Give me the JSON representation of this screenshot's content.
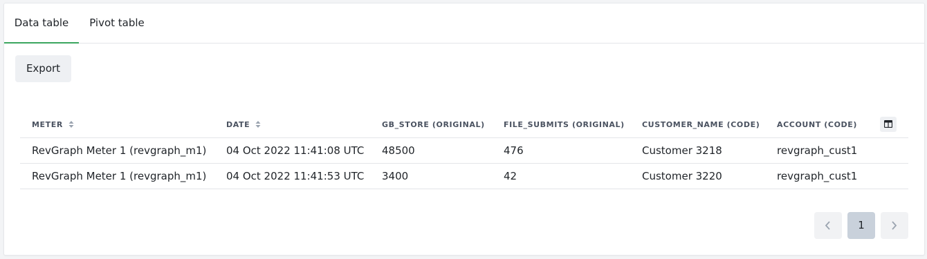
{
  "tabs": [
    {
      "label": "Data table",
      "active": true
    },
    {
      "label": "Pivot table",
      "active": false
    }
  ],
  "toolbar": {
    "export_label": "Export"
  },
  "table": {
    "columns": [
      {
        "label": "METER",
        "sortable": true
      },
      {
        "label": "DATE",
        "sortable": true
      },
      {
        "label": "GB_STORE (ORIGINAL)",
        "sortable": false
      },
      {
        "label": "FILE_SUBMITS (ORIGINAL)",
        "sortable": false
      },
      {
        "label": "CUSTOMER_NAME (CODE)",
        "sortable": false
      },
      {
        "label": "ACCOUNT (CODE)",
        "sortable": false
      }
    ],
    "column_toggle_icon": "columns-icon",
    "rows": [
      [
        "RevGraph Meter 1 (revgraph_m1)",
        "04 Oct 2022 11:41:08 UTC",
        "48500",
        "476",
        "Customer 3218",
        "revgraph_cust1"
      ],
      [
        "RevGraph Meter 1 (revgraph_m1)",
        "04 Oct 2022 11:41:53 UTC",
        "3400",
        "42",
        "Customer 3220",
        "revgraph_cust1"
      ]
    ]
  },
  "pagination": {
    "prev_icon": "chevron-left-icon",
    "current_page": "1",
    "next_icon": "chevron-right-icon"
  },
  "colors": {
    "active_tab_underline": "#3aa55e",
    "button_bg": "#eef0f3",
    "current_page_bg": "#c9d1db"
  }
}
